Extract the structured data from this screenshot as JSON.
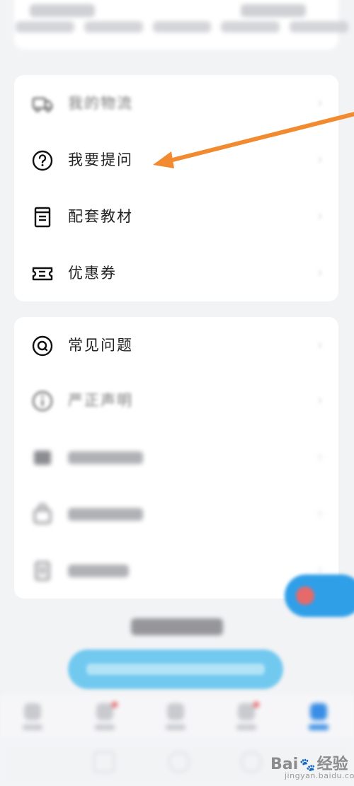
{
  "menu_section_1": {
    "items": [
      {
        "label": "我的物流",
        "icon": "truck-icon",
        "blurred": true
      },
      {
        "label": "我要提问",
        "icon": "question-circle-icon",
        "blurred": false
      },
      {
        "label": "配套教材",
        "icon": "book-icon",
        "blurred": false
      },
      {
        "label": "优惠券",
        "icon": "ticket-icon",
        "blurred": false
      }
    ]
  },
  "menu_section_2": {
    "items": [
      {
        "label": "常见问题",
        "icon": "faq-icon",
        "blurred": false
      },
      {
        "label": "严正声明",
        "icon": "info-icon",
        "blurred": true
      },
      {
        "label": "",
        "icon": "message-icon",
        "blurred": true
      },
      {
        "label": "",
        "icon": "bag-icon",
        "blurred": true
      },
      {
        "label": "",
        "icon": "document-icon",
        "blurred": true
      }
    ]
  },
  "annotation": {
    "color": "#f28a30"
  },
  "colors": {
    "accent": "#3a8ee6",
    "cta": "#72c9ef",
    "badge": "#e85b5b"
  },
  "watermark": {
    "brand": "Bai",
    "brand_end": "经验",
    "sub": "jingyan.baidu.com"
  }
}
